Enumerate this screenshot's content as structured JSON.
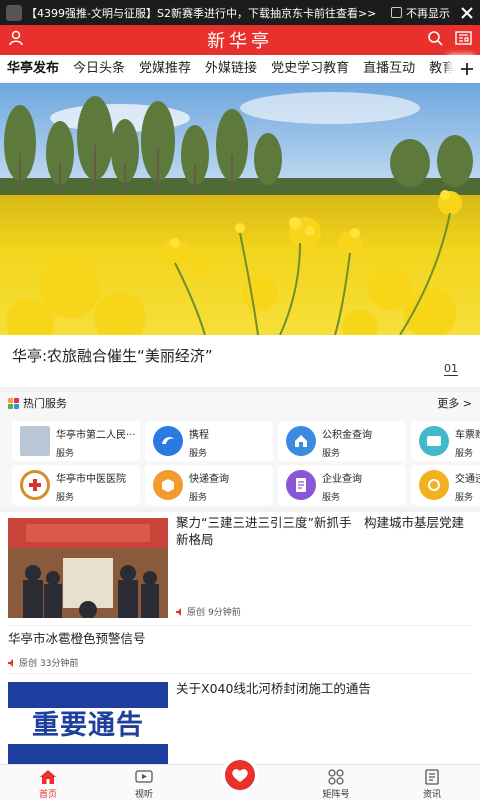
{
  "notification": {
    "text": "【4399强推-文明与征服】S2新赛季进行中，下载抽京东卡前往查看>>",
    "dismiss_label": "不再显示"
  },
  "header": {
    "title": "新华亭"
  },
  "tabs": [
    {
      "label": "华亭发布",
      "active": true
    },
    {
      "label": "今日头条"
    },
    {
      "label": "党媒推荐"
    },
    {
      "label": "外媒链接"
    },
    {
      "label": "党史学习教育"
    },
    {
      "label": "直播互动"
    },
    {
      "label": "教育在线"
    }
  ],
  "hero": {
    "caption": "华亭:农旅融合催生“美丽经济”",
    "pager": "01"
  },
  "services": {
    "title": "热门服务",
    "more_label": "更多 >",
    "items": [
      {
        "name": "华亭市第二人民···",
        "tag": "服务",
        "icon": "hospital-photo",
        "color": "#b9c6d6"
      },
      {
        "name": "携程",
        "tag": "服务",
        "icon": "ctrip-icon",
        "color": "#2a7ae2"
      },
      {
        "name": "公积金查询",
        "tag": "服务",
        "icon": "house-icon",
        "color": "#3d8be0"
      },
      {
        "name": "车票购",
        "tag": "服务",
        "icon": "ticket-icon",
        "color": "#41b9c9"
      },
      {
        "name": "华亭市中医医院",
        "tag": "服务",
        "icon": "hospital-logo-icon",
        "color": "#d58d2a"
      },
      {
        "name": "快递查询",
        "tag": "服务",
        "icon": "box-icon",
        "color": "#f29a2e"
      },
      {
        "name": "企业查询",
        "tag": "服务",
        "icon": "company-icon",
        "color": "#8a56d6"
      },
      {
        "name": "交通违",
        "tag": "服务",
        "icon": "traffic-icon",
        "color": "#f0b21e"
      }
    ]
  },
  "news": [
    {
      "headline": "聚力“三建三进三引三度”新抓手　构建城市基层党建新格局",
      "source": "原创",
      "time": "9分钟前"
    },
    {
      "headline": "华亭市冰雹橙色预警信号",
      "source": "原创",
      "time": "33分钟前"
    },
    {
      "headline": "关于X040线北河桥封闭施工的通告",
      "thumb_text": "重要通告"
    }
  ],
  "bottom_nav": [
    {
      "label": "首页",
      "active": true
    },
    {
      "label": "视听"
    },
    {
      "label": "矩阵号"
    },
    {
      "label": "资讯"
    }
  ],
  "colors": {
    "brand_red": "#e8302c",
    "rapeseed_yellow": "#f3d31a",
    "sky_blue": "#7fb3e6"
  }
}
